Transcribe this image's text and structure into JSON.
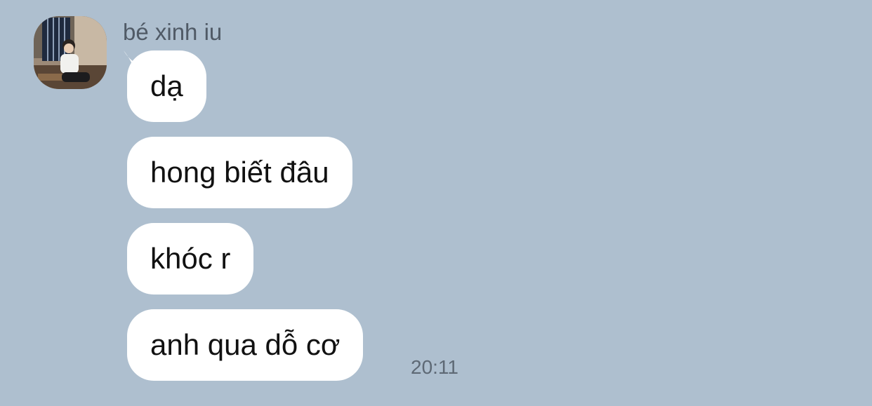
{
  "chat": {
    "sender_name": "bé xinh iu",
    "messages": [
      {
        "text": "dạ"
      },
      {
        "text": "hong biết đâu"
      },
      {
        "text": "khóc r"
      },
      {
        "text": "anh qua dỗ cơ"
      }
    ],
    "last_time": "20:11"
  },
  "colors": {
    "background": "#aebfcf",
    "bubble": "#ffffff",
    "sender_text": "#505a66",
    "message_text": "#111111",
    "time_text": "#5e6975"
  }
}
